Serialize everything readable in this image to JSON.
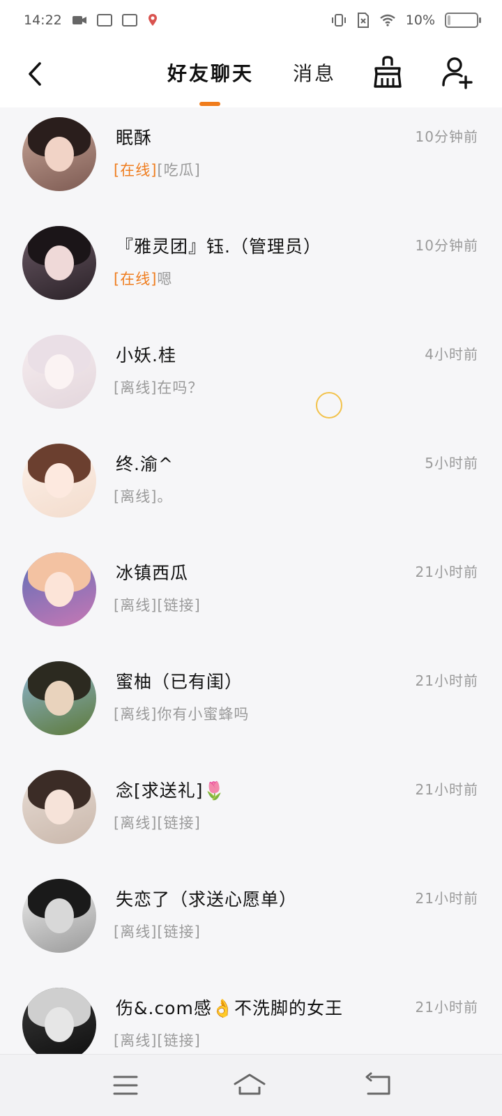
{
  "status_bar": {
    "time": "14:22",
    "battery": "10%",
    "battery_level": 0.1,
    "icons": [
      "video-icon",
      "app-icon",
      "vivo-icon",
      "location-icon",
      "vibrate-icon",
      "no-sim-icon",
      "wifi-icon",
      "battery-icon"
    ]
  },
  "header": {
    "back_icon": "chevron-left-icon",
    "tabs": [
      {
        "label": "好友聊天",
        "active": true
      },
      {
        "label": "消息",
        "active": false
      }
    ],
    "clean_icon": "broom-icon",
    "add_friend_icon": "add-user-icon",
    "accent": "#f07c1b"
  },
  "chats": [
    {
      "name": "眠酥",
      "time": "10分钟前",
      "status": "[在线]",
      "online": true,
      "message": "[吃瓜]"
    },
    {
      "name": "『雅灵团』钰.（管理员）",
      "time": "10分钟前",
      "status": "[在线]",
      "online": true,
      "message": "嗯"
    },
    {
      "name": "小妖.桂",
      "time": "4小时前",
      "status": "[离线]",
      "online": false,
      "message": "在吗？"
    },
    {
      "name": "终.渝^",
      "time": "5小时前",
      "status": "[离线]",
      "online": false,
      "message": "。"
    },
    {
      "name": "冰镇西瓜",
      "time": "21小时前",
      "status": "[离线]",
      "online": false,
      "message": "[链接]"
    },
    {
      "name": "蜜柚（已有闺）",
      "time": "21小时前",
      "status": "[离线]",
      "online": false,
      "message": "你有小蜜蜂吗"
    },
    {
      "name": "念[求送礼]🌷",
      "time": "21小时前",
      "status": "[离线]",
      "online": false,
      "message": "[链接]"
    },
    {
      "name": "失恋了（求送心愿单）",
      "time": "21小时前",
      "status": "[离线]",
      "online": false,
      "message": "[链接]"
    },
    {
      "name": "伤&.com感👌不洗脚的女王",
      "time": "21小时前",
      "status": "[离线]",
      "online": false,
      "message": "[链接]"
    }
  ],
  "colors": {
    "online": "#ef7d1f",
    "offline": "#9a9a9a",
    "background": "#f6f6f8"
  },
  "navbar": {
    "icons": [
      "menu-icon",
      "home-icon",
      "back-icon"
    ]
  }
}
